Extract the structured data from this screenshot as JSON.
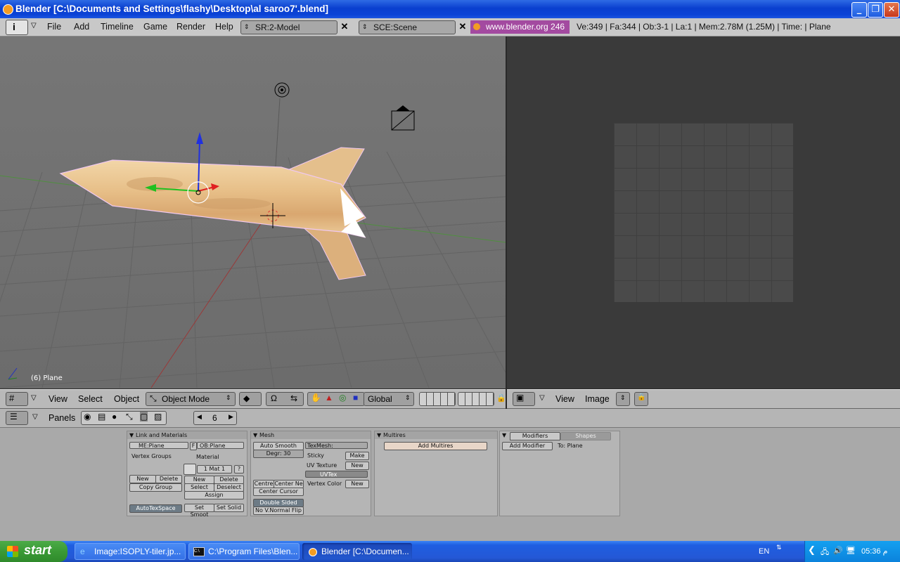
{
  "window": {
    "title": "Blender [C:\\Documents and Settings\\flashy\\Desktop\\al saroo7'.blend]",
    "min": "_",
    "max": "❐",
    "close": "✕"
  },
  "info_header": {
    "menus": [
      "File",
      "Add",
      "Timeline",
      "Game",
      "Render",
      "Help"
    ],
    "screen_field": "SR:2-Model",
    "scene_field": "SCE:Scene",
    "link": "www.blender.org 246",
    "stats": "Ve:349 | Fa:344 | Ob:3-1 | La:1  | Mem:2.78M (1.25M)  | Time: | Plane"
  },
  "viewport": {
    "object_label": "(6) Plane"
  },
  "view3d_header": {
    "menus": [
      "View",
      "Select",
      "Object"
    ],
    "mode": "Object Mode",
    "orientation": "Global"
  },
  "image_header": {
    "menus": [
      "View",
      "Image"
    ]
  },
  "buttons_header": {
    "panels_label": "Panels",
    "frame": "6"
  },
  "panels": {
    "link_materials": {
      "title": "Link and Materials",
      "me_field": "ME:Plane",
      "f_label": "F",
      "ob_field": "OB:Plane",
      "vertex_groups": "Vertex Groups",
      "material": "Material",
      "mat_field": "1 Mat 1",
      "q": "?",
      "new": "New",
      "delete": "Delete",
      "copy_group": "Copy Group",
      "mat_new": "New",
      "mat_delete": "Delete",
      "select": "Select",
      "deselect": "Deselect",
      "assign": "Assign",
      "autotexspace": "AutoTexSpace",
      "set_smooth": "Set Smoot",
      "set_solid": "Set Solid"
    },
    "mesh": {
      "title": "Mesh",
      "auto_smooth": "Auto Smooth",
      "degr": "Degr: 30",
      "centre": "Centre",
      "centre_new": "Center Ne",
      "center_cursor": "Center Cursor",
      "double_sided": "Double Sided",
      "no_vnormal_flip": "No V.Normal Flip",
      "texmesh": "TexMesh:",
      "sticky": "Sticky",
      "make": "Make",
      "uv_texture": "UV Texture",
      "uv_new": "New",
      "uvtex": "UVTex",
      "vertex_color": "Vertex Color",
      "vc_new": "New"
    },
    "multires": {
      "title": "Multires",
      "add": "Add Multires"
    },
    "modifiers": {
      "tab1": "Modifiers",
      "tab2": "Shapes",
      "add": "Add Modifier",
      "to": "To: Plane"
    }
  },
  "taskbar": {
    "start": "start",
    "tasks": [
      "Image:ISOPLY-tiler.jp...",
      "C:\\Program Files\\Blen...",
      "Blender [C:\\Documen..."
    ],
    "lang": "EN",
    "clock": "05:36 م"
  },
  "colors": {
    "link_bg": "#a34aa0",
    "xp_blue": "#0b43d6",
    "start_green": "#3a9a35"
  }
}
